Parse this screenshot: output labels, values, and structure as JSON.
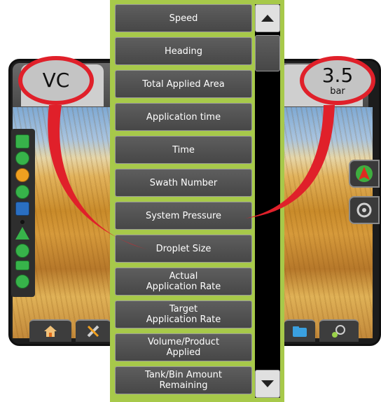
{
  "left_value": {
    "text": "VC"
  },
  "right_value": {
    "value": "3.5",
    "unit": "bar"
  },
  "options": [
    "Speed",
    "Heading",
    "Total Applied Area",
    "Application time",
    "Time",
    "Swath Number",
    "System Pressure",
    "Droplet Size",
    "Actual\nApplication Rate",
    "Target\nApplication Rate",
    "Volume/Product\nApplied",
    "Tank/Bin Amount\nRemaining"
  ],
  "colors": {
    "panel_border": "#a7c94a",
    "callout": "#e0202a",
    "button": "#545454"
  },
  "icons": {
    "scroll_up": "triangle-up-icon",
    "scroll_down": "triangle-down-icon",
    "home": "home-icon",
    "tools": "tools-icon",
    "folder": "folder-icon",
    "gps": "gps-icon",
    "guidance": "guidance-arrow-icon",
    "target": "target-icon"
  }
}
